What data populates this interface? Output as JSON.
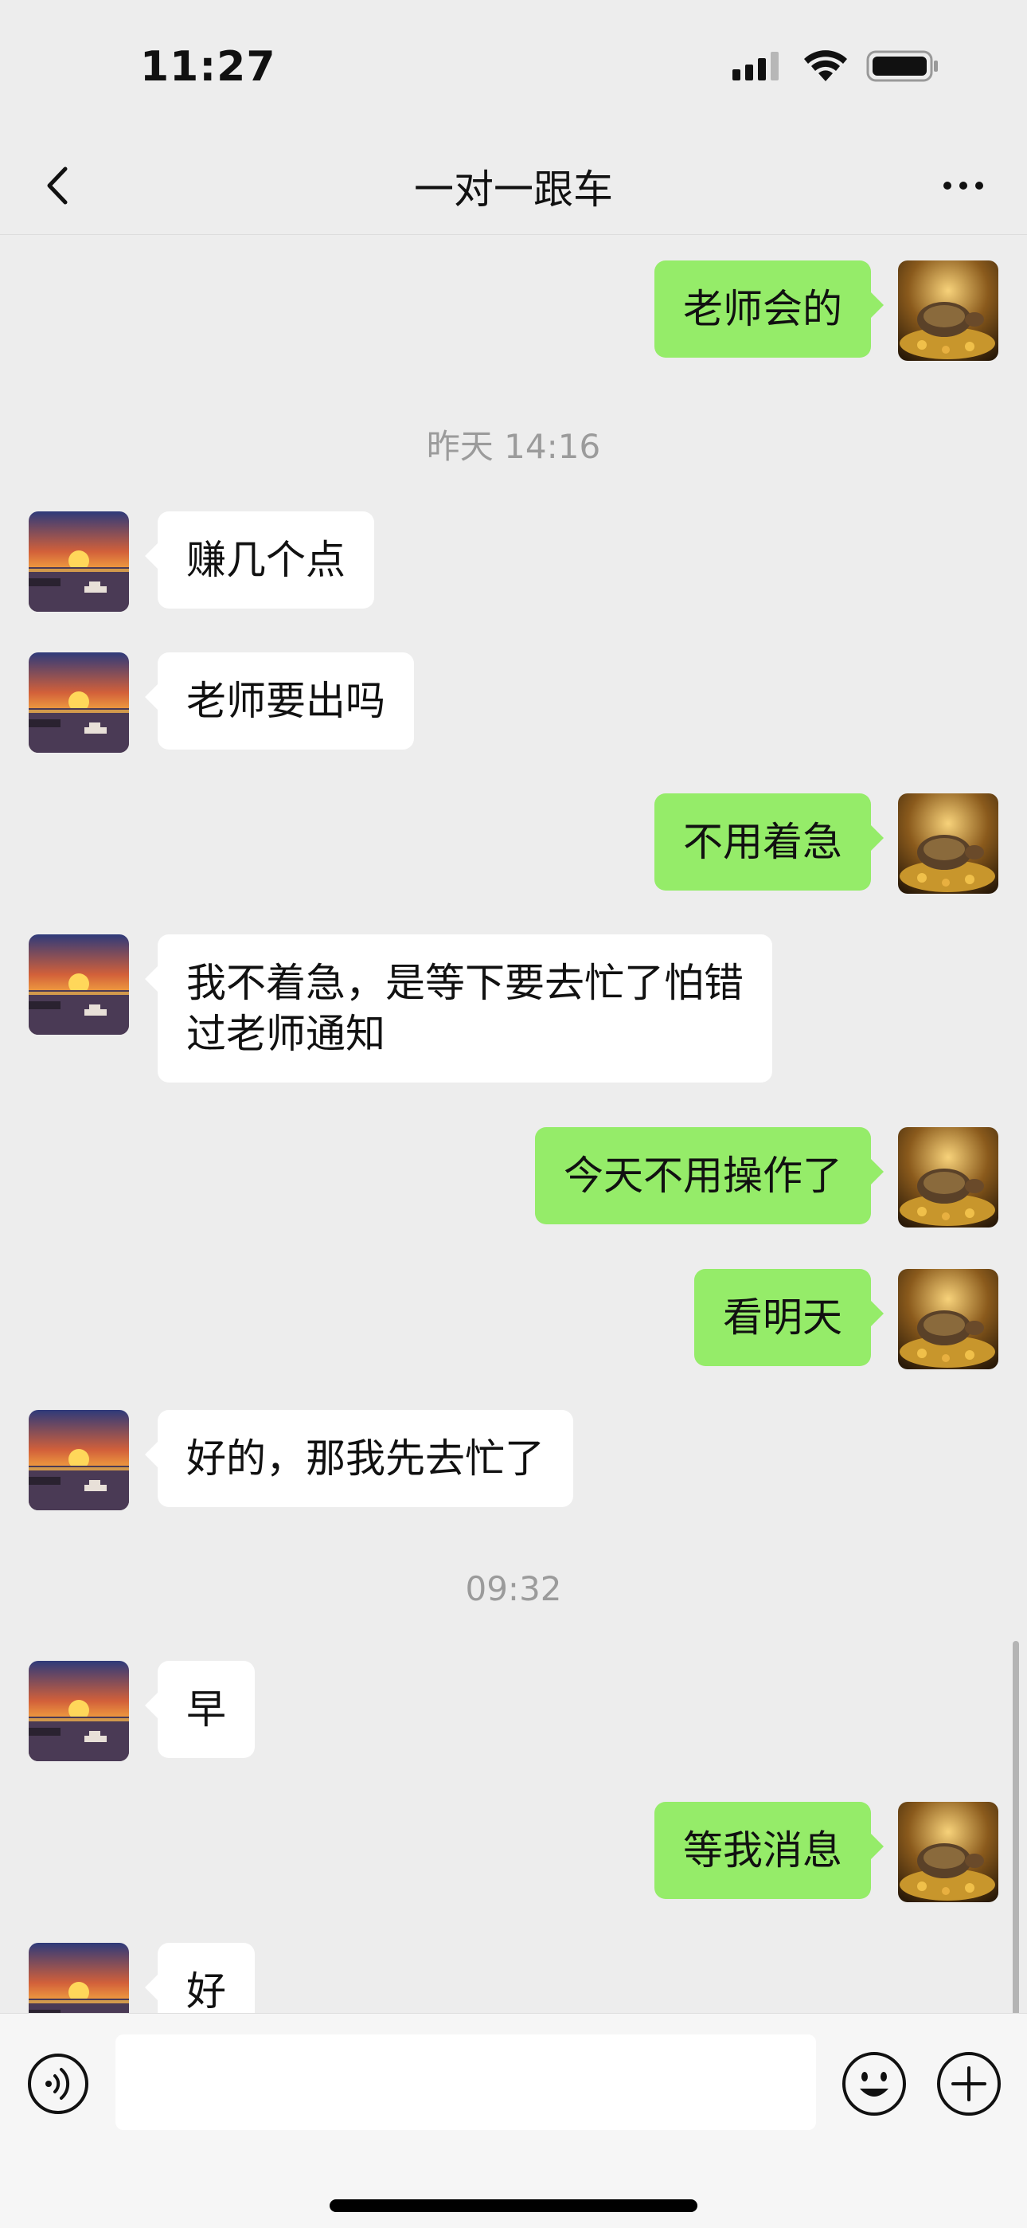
{
  "status": {
    "time": "11:27"
  },
  "header": {
    "title": "一对一跟车"
  },
  "messages": [
    {
      "side": "out",
      "text": "老师会的"
    },
    {
      "type": "time",
      "text": "昨天 14:16"
    },
    {
      "side": "in",
      "text": "赚几个点"
    },
    {
      "side": "in",
      "text": "老师要出吗"
    },
    {
      "side": "out",
      "text": "不用着急"
    },
    {
      "side": "in",
      "text": "我不着急，是等下要去忙了怕错\n过老师通知"
    },
    {
      "side": "out",
      "text": "今天不用操作了"
    },
    {
      "side": "out",
      "text": "看明天"
    },
    {
      "side": "in",
      "text": "好的，那我先去忙了"
    },
    {
      "type": "time",
      "text": "09:32"
    },
    {
      "side": "in",
      "text": "早"
    },
    {
      "side": "out",
      "text": "等我消息"
    },
    {
      "side": "in",
      "text": "好"
    }
  ],
  "input": {
    "value": ""
  },
  "colors": {
    "out_bubble": "#95ec69",
    "in_bubble": "#ffffff",
    "background": "#ededed"
  },
  "icons": [
    "signal-icon",
    "wifi-icon",
    "battery-icon",
    "back-icon",
    "more-icon",
    "voice-icon",
    "emoji-icon",
    "plus-icon"
  ]
}
